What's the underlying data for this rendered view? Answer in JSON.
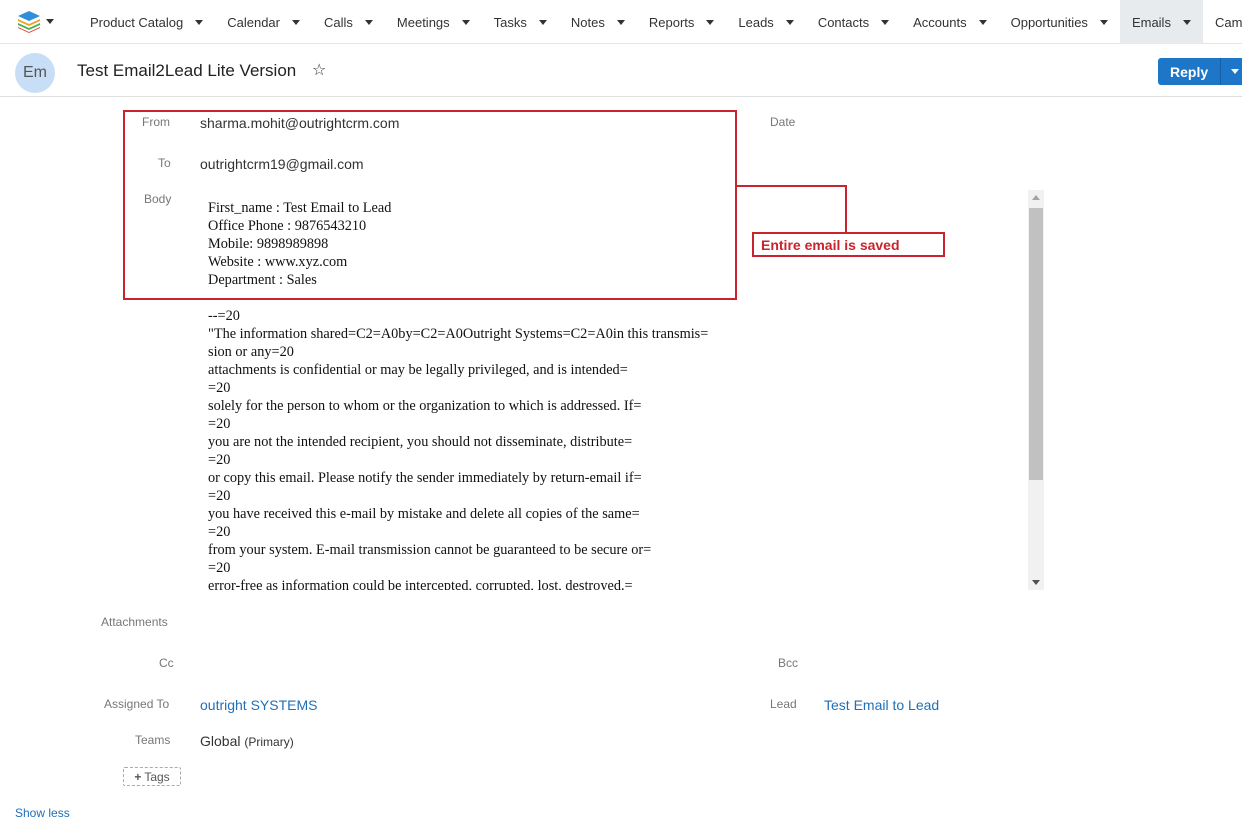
{
  "nav": {
    "items": [
      {
        "label": "Product Catalog"
      },
      {
        "label": "Calendar"
      },
      {
        "label": "Calls"
      },
      {
        "label": "Meetings"
      },
      {
        "label": "Tasks"
      },
      {
        "label": "Notes"
      },
      {
        "label": "Reports"
      },
      {
        "label": "Leads"
      },
      {
        "label": "Contacts"
      },
      {
        "label": "Accounts"
      },
      {
        "label": "Opportunities"
      },
      {
        "label": "Emails"
      },
      {
        "label": "Campaigns"
      }
    ],
    "active": "Emails"
  },
  "header": {
    "avatar_text": "Em",
    "title": "Test Email2Lead Lite Version",
    "reply_label": "Reply"
  },
  "fields": {
    "from_label": "From",
    "from_value": "sharma.mohit@outrightcrm.com",
    "date_label": "Date",
    "to_label": "To",
    "to_value": "outrightcrm19@gmail.com",
    "body_label": "Body",
    "attachments_label": "Attachments",
    "cc_label": "Cc",
    "bcc_label": "Bcc",
    "assigned_label": "Assigned To",
    "assigned_value": "outright SYSTEMS",
    "lead_label": "Lead",
    "lead_value": "Test Email to Lead",
    "teams_label": "Teams",
    "teams_value": "Global",
    "teams_primary": "(Primary)",
    "tags_label": "Tags"
  },
  "body_lines": [
    "First_name : Test Email to Lead",
    "Office Phone : 9876543210",
    "Mobile: 9898989898",
    "Website : www.xyz.com",
    "Department : Sales",
    "",
    "--=20",
    "\"The information shared=C2=A0by=C2=A0Outright Systems=C2=A0in this transmis=",
    "sion or any=20",
    "attachments is confidential or may be legally privileged, and is intended=",
    "=20",
    "solely for the person to whom or the organization to which is addressed. If=",
    "=20",
    "you are not the intended recipient, you should not disseminate, distribute=",
    "=20",
    "or copy this email. Please notify the sender immediately by return-email if=",
    "=20",
    "you have received this e-mail by mistake and delete all copies of the same=",
    "=20",
    "from your system. E-mail transmission cannot be guaranteed to be secure or=",
    "=20",
    "error-free as information could be intercepted, corrupted, lost, destroyed.="
  ],
  "annotation": {
    "label": "Entire email is saved",
    "color": "#c8242e"
  },
  "footer": {
    "show_less": "Show less"
  }
}
